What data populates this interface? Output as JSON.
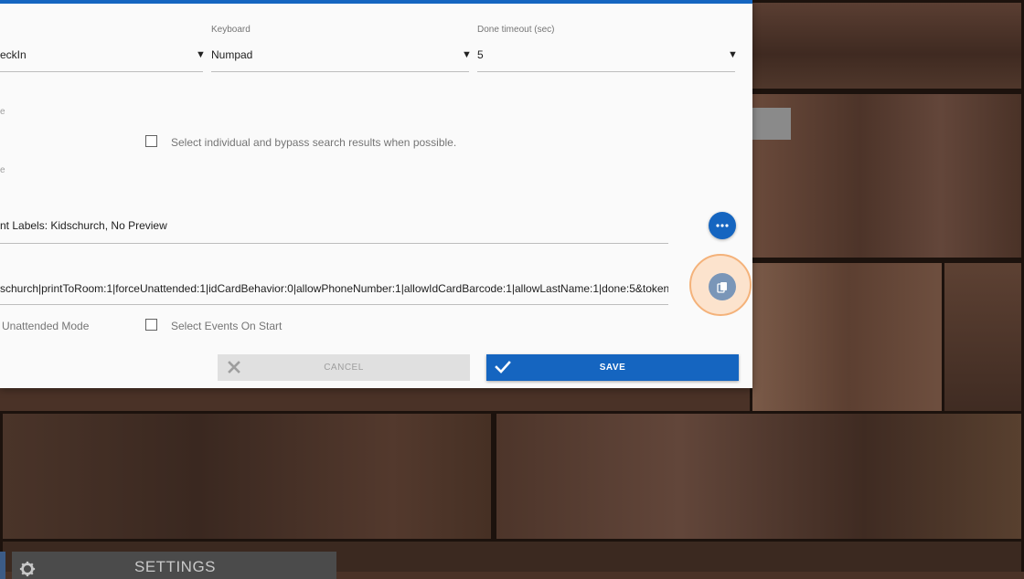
{
  "dialog": {
    "row1": {
      "first_select_value": "eckIn",
      "keyboard_label": "Keyboard",
      "keyboard_value": "Numpad",
      "done_timeout_label": "Done timeout (sec)",
      "done_timeout_value": "5",
      "dropdown_arrow": "▼"
    },
    "faint_labels": [
      "e",
      "e"
    ],
    "bypass_checkbox_label": "Select individual and bypass search results when possible.",
    "labels_value": "nt Labels: Kidschurch,  No Preview",
    "url_value": "schurch|printToRoom:1|forceUnattended:1|idCardBehavior:0|allowPhoneNumber:1|allowIdCardBarcode:1|allowLastName:1|done:5&token",
    "unattended_label": "Unattended Mode",
    "select_events_label": "Select Events On Start",
    "cancel_label": "CANCEL",
    "save_label": "SAVE"
  },
  "settings_bar": {
    "label": "SETTINGS"
  },
  "colors": {
    "accent": "#1565c0",
    "highlight": "#f4b27a"
  },
  "icons": [
    "ellipsis-icon",
    "copy-icon",
    "x-icon",
    "checkmark-icon",
    "gear-icon"
  ]
}
